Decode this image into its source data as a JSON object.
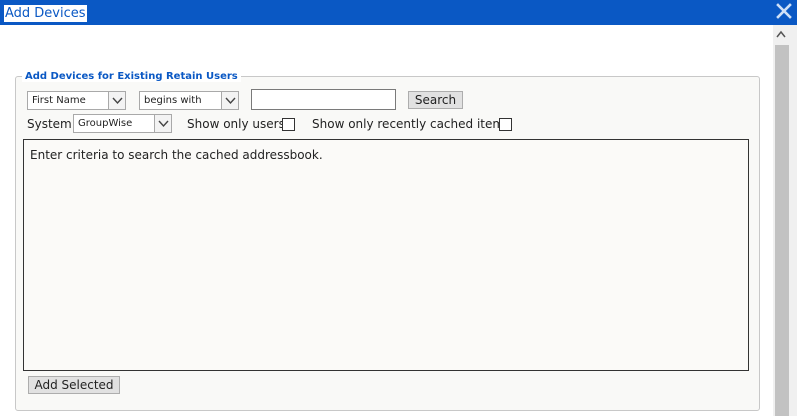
{
  "window": {
    "title": "Add Devices",
    "close_icon": "close-icon"
  },
  "group": {
    "legend": "Add Devices for Existing Retain Users"
  },
  "search": {
    "field_selected": "First Name",
    "operator_selected": "begins with",
    "query_value": "",
    "search_label": "Search"
  },
  "filters": {
    "system_label": "System",
    "system_selected": "GroupWise",
    "show_only_users_label": "Show only users",
    "show_only_users_checked": false,
    "show_recent_label": "Show only recently cached items",
    "show_recent_checked": false
  },
  "results": {
    "message": "Enter criteria to search the cached addressbook."
  },
  "footer": {
    "add_selected_label": "Add Selected"
  },
  "colors": {
    "title_bar": "#0a58c4",
    "legend_text": "#0a58c4"
  }
}
